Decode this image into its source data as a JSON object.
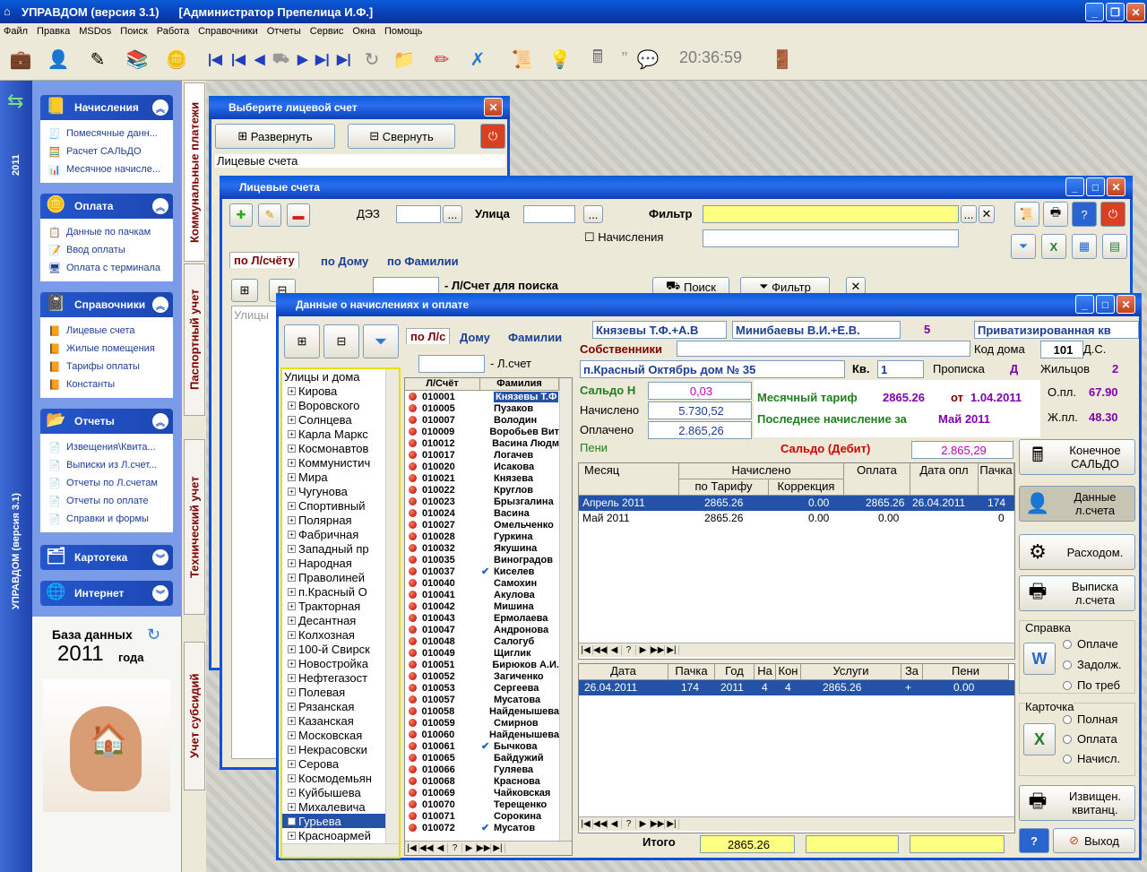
{
  "app": {
    "title": "УПРАВДОМ (версия 3.1)",
    "user": "[Администратор Препелица И.Ф.]"
  },
  "menu": [
    "Файл",
    "Правка",
    "MSDos",
    "Поиск",
    "Работа",
    "Справочники",
    "Отчеты",
    "Сервис",
    "Окна",
    "Помощь"
  ],
  "toolbar": {
    "clock": "20:36:59"
  },
  "leftbar": {
    "year": "2011",
    "vtitle": "УПРАВДОМ (версия 3.1)"
  },
  "panel": {
    "groups": [
      {
        "title": "Начисления",
        "items": [
          "Помесячные данн...",
          "Расчет САЛЬДО",
          "Месячное начисле..."
        ]
      },
      {
        "title": "Оплата",
        "items": [
          "Данные по пачкам",
          "Ввод оплаты",
          "Оплата с терминала"
        ]
      },
      {
        "title": "Справочники",
        "items": [
          "Лицевые счета",
          "Жилые помещения",
          "Тарифы оплаты",
          "Константы"
        ]
      },
      {
        "title": "Отчеты",
        "items": [
          "Извещения\\Квита...",
          "Выписки из Л.счет...",
          "Отчеты по Л.счетам",
          "Отчеты по оплате",
          "Справки и формы"
        ]
      }
    ],
    "collapsed": [
      "Картотека",
      "Интернет"
    ],
    "db_label": "База данных",
    "db_year": "2011",
    "db_suffix": "года"
  },
  "vtabs": [
    "Коммунальные платежи",
    "Паспортный учет",
    "Технический учет",
    "Учет субсидий"
  ],
  "win1": {
    "title": "Выберите лицевой счет",
    "expand": "Развернуть",
    "collapse": "Свернуть",
    "list_header": "Лицевые счета"
  },
  "win2": {
    "title": "Лицевые счета",
    "dez": "ДЭЗ",
    "street": "Улица",
    "filter": "Фильтр",
    "accruals_check": "Начисления",
    "tabs": [
      "по Л/счёту",
      "по Дому",
      "по Фамилии"
    ],
    "search_label": "- Л/Счет для поиска",
    "search_btn": "Поиск",
    "filter_btn": "Фильтр",
    "streets_hdr": "Улицы"
  },
  "win3": {
    "title": "Данные о начислениях и оплате",
    "tabs": [
      "по Л/с",
      "Дому",
      "Фамилии"
    ],
    "acct_label": "- Л.счет",
    "tree_header": "Улицы и дома",
    "streets": [
      "Кирова",
      "Воровского",
      "Солнцева",
      "Карла Маркс",
      "Космонавтов",
      "Коммунистич",
      "Мира",
      "Чугунова",
      "Спортивный",
      "Полярная",
      "Фабричная",
      "Западный пр",
      "Народная",
      "Праволиней",
      "п.Красный О",
      "Тракторная",
      "Десантная",
      "Колхозная",
      "100-й Свирск",
      "Новостройка",
      "Нефтегазост",
      "Полевая",
      "Рязанская",
      "Казанская",
      "Московская",
      "Некрасовски",
      "Серова",
      "Космодемьян",
      "Куйбышева",
      "Михалевича",
      "Гурьева",
      "Красноармей"
    ],
    "acct_hdr": [
      "Л/Счёт",
      "Фамилия"
    ],
    "accounts": [
      [
        "010001",
        "Князевы Т.Ф",
        ""
      ],
      [
        "010005",
        "Пузаков",
        ""
      ],
      [
        "010007",
        "Володин",
        ""
      ],
      [
        "010009",
        "Воробьев Вит",
        ""
      ],
      [
        "010012",
        "Васина Людм",
        ""
      ],
      [
        "010017",
        "Логачев",
        ""
      ],
      [
        "010020",
        "Исакова",
        ""
      ],
      [
        "010021",
        "Князева",
        ""
      ],
      [
        "010022",
        "Круглов",
        ""
      ],
      [
        "010023",
        "Брызгалина",
        ""
      ],
      [
        "010024",
        "Васина",
        ""
      ],
      [
        "010027",
        "Омельченко",
        ""
      ],
      [
        "010028",
        "Гуркина",
        ""
      ],
      [
        "010032",
        "Якушина",
        ""
      ],
      [
        "010035",
        "Виноградов",
        ""
      ],
      [
        "010037",
        "Киселев",
        "check"
      ],
      [
        "010040",
        "Самохин",
        ""
      ],
      [
        "010041",
        "Акулова",
        ""
      ],
      [
        "010042",
        "Мишина",
        ""
      ],
      [
        "010043",
        "Ермолаева",
        ""
      ],
      [
        "010047",
        "Андронова",
        ""
      ],
      [
        "010048",
        "Салогуб",
        ""
      ],
      [
        "010049",
        "Щиглик",
        ""
      ],
      [
        "010051",
        "Бирюков А.И.",
        ""
      ],
      [
        "010052",
        "Загиченко",
        ""
      ],
      [
        "010053",
        "Сергеева",
        ""
      ],
      [
        "010057",
        "Мусатова",
        ""
      ],
      [
        "010058",
        "Найденышева",
        ""
      ],
      [
        "010059",
        "Смирнов",
        ""
      ],
      [
        "010060",
        "Найденышева",
        ""
      ],
      [
        "010061",
        "Бычкова",
        "check"
      ],
      [
        "010065",
        "Байдужий",
        ""
      ],
      [
        "010066",
        "Гуляева",
        ""
      ],
      [
        "010068",
        "Краснова",
        ""
      ],
      [
        "010069",
        "Чайковская",
        ""
      ],
      [
        "010070",
        "Терещенко",
        ""
      ],
      [
        "010071",
        "Сорокина",
        ""
      ],
      [
        "010072",
        "Мусатов",
        "check"
      ]
    ],
    "owner1": "Князевы Т.Ф.+А.В",
    "owner2": "Минибаевы В.И.+Е.В.",
    "rooms": "5",
    "ptype": "Приватизированная кв",
    "owners_label": "Собственники",
    "code_label": "Код дома",
    "code": "101",
    "ds": "Д.С.",
    "address": "п.Красный Октябрь дом № 35",
    "kv_label": "Кв.",
    "kv": "1",
    "prop_label": "Прописка",
    "prop": "Д",
    "resid_label": "Жильцов",
    "resid": "2",
    "saldo_n_label": "Сальдо Н",
    "saldo_n": "0,03",
    "accrued_label": "Начислено",
    "accrued": "5.730,52",
    "paid_label": "Оплачено",
    "paid": "2.865,26",
    "peni_label": "Пени",
    "monthly_label": "Месячный тариф",
    "monthly": "2865.26",
    "from_label": "от",
    "from": "1.04.2011",
    "last_label": "Последнее начисление за",
    "last": "Май 2011",
    "opl_label": "О.пл.",
    "opl": "67.90",
    "zhpl_label": "Ж.пл.",
    "zhpl": "48.30",
    "saldo_d_label": "Сальдо (Дебит)",
    "saldo_d": "2.865,29",
    "grid1_hdr": {
      "month": "Месяц",
      "acc": "Начислено",
      "by_tariff": "по Тарифу",
      "corr": "Коррекция",
      "pay": "Оплата",
      "pay_date": "Дата опл",
      "pack": "Пачка"
    },
    "grid1_rows": [
      [
        "Апрель 2011",
        "2865.26",
        "0.00",
        "2865.26",
        "26.04.2011",
        "174"
      ],
      [
        "Май 2011",
        "2865.26",
        "0.00",
        "0.00",
        "",
        "0"
      ]
    ],
    "grid2_hdr": [
      "Дата",
      "Пачка",
      "Год",
      "На",
      "Кон",
      "Услуги",
      "За",
      "Пени"
    ],
    "grid2_rows": [
      [
        "26.04.2011",
        "174",
        "2011",
        "4",
        "4",
        "2865.26",
        "+",
        "0.00"
      ]
    ],
    "total_label": "Итого",
    "total": "2865.26",
    "side": {
      "final": "Конечное САЛЬДО",
      "data": "Данные л.счета",
      "expense": "Расходом.",
      "extract": "Выписка л.счета",
      "notice": "Извищен. квитанц.",
      "exit": "Выход"
    },
    "spravka": {
      "label": "Справка",
      "opts": [
        "Оплаче",
        "Задолж.",
        "По треб"
      ]
    },
    "kartochka": {
      "label": "Карточка",
      "opts": [
        "Полная",
        "Оплата",
        "Начисл."
      ]
    }
  }
}
